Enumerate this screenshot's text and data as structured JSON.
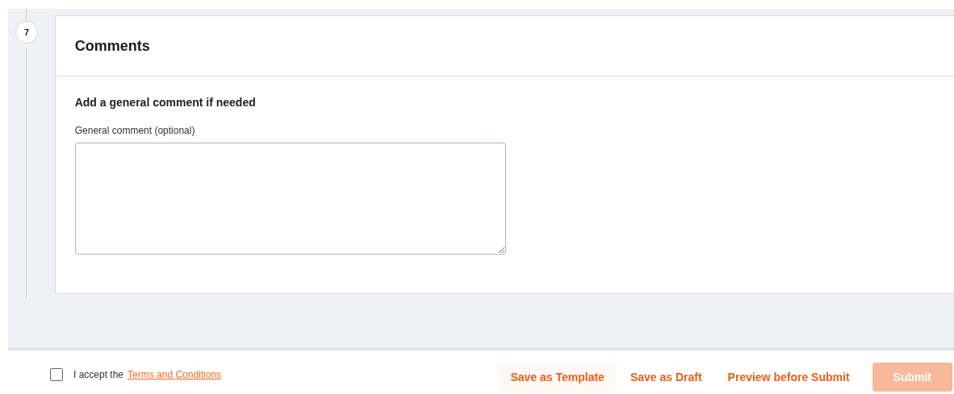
{
  "step": {
    "number": "7",
    "title": "Comments"
  },
  "section": {
    "heading": "Add a general comment if needed",
    "field_label": "General comment (optional)"
  },
  "footer": {
    "accept": {
      "checked": false,
      "text": "I accept the",
      "link": "Terms and Conditions"
    },
    "buttons": [
      {
        "label": "Save as Template",
        "kind": "tinted",
        "disabled": false
      },
      {
        "label": "Save as Draft",
        "kind": "text",
        "disabled": false
      },
      {
        "label": "Preview before Submit",
        "kind": "text",
        "disabled": false
      },
      {
        "label": "Submit",
        "kind": "primary",
        "disabled": true
      }
    ]
  }
}
